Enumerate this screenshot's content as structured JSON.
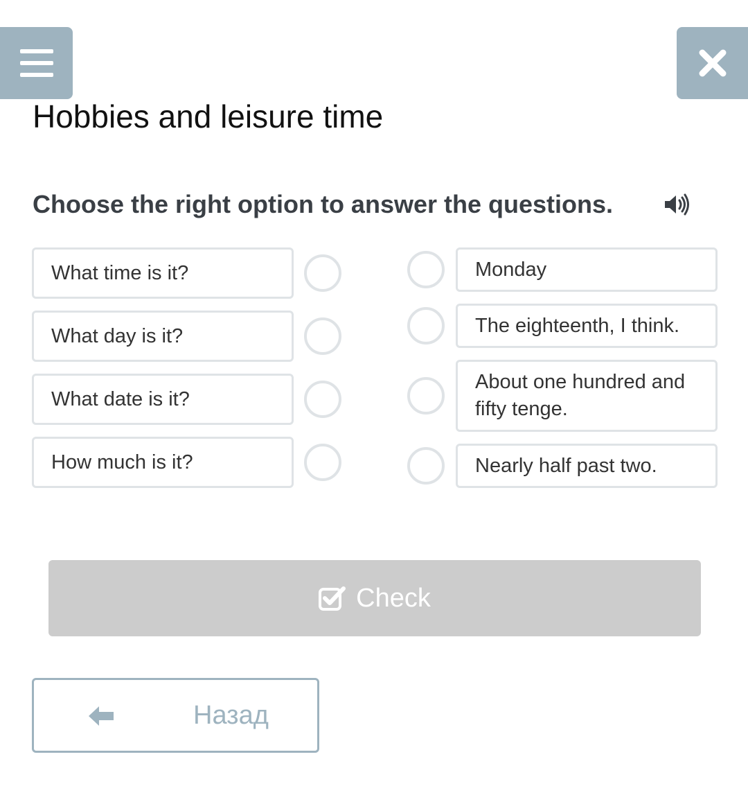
{
  "header": {
    "menu_icon": "hamburger-menu-icon",
    "close_icon": "close-x-icon",
    "accent_color": "#9eb3bf"
  },
  "page_title": "Hobbies and leisure time",
  "instruction": "Choose the right option to answer the questions.",
  "instruction_icon": "speaker-audio-icon",
  "questions": [
    "What time is it?",
    "What day is it?",
    "What date is it?",
    "How much is it?"
  ],
  "answers": [
    "Monday",
    "The eighteenth, I think.",
    "About one hundred and fifty tenge.",
    "Nearly half past two."
  ],
  "check_button": {
    "label": "Check",
    "icon": "checkbox-checked-icon",
    "background": "#cccccc"
  },
  "back_button": {
    "label": "Назад",
    "icon": "arrow-left-icon"
  }
}
